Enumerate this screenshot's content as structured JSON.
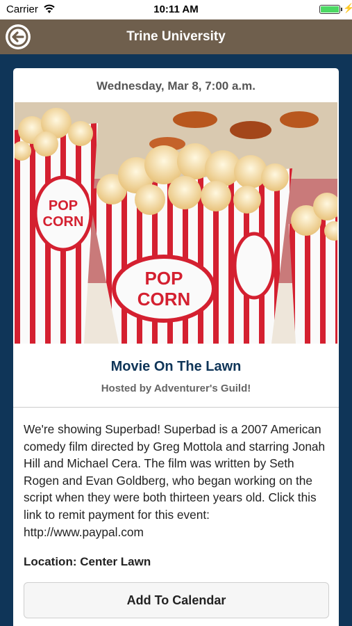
{
  "status_bar": {
    "carrier": "Carrier",
    "time": "10:11 AM"
  },
  "nav": {
    "title": "Trine University"
  },
  "event": {
    "date": "Wednesday, Mar 8, 7:00 a.m.",
    "title": "Movie On The Lawn",
    "host": "Hosted by Adventurer's Guild!",
    "description": "We're showing Superbad! Superbad is a 2007 American comedy film directed by Greg Mottola and starring Jonah Hill and Michael Cera. The film was written by Seth Rogen and Evan Goldberg, who began working on the script when they were both thirteen years old. Click this link to remit payment for this event: http://www.paypal.com",
    "location": "Location: Center Lawn",
    "calendar_button": "Add To Calendar",
    "image_labels": {
      "pop": "POP",
      "corn": "CORN"
    }
  },
  "colors": {
    "nav": "#6f5f4d",
    "background": "#0f3558",
    "title": "#0f3558",
    "popcorn_red": "#d42030"
  },
  "icons": {
    "back": "back-arrow-icon",
    "wifi": "wifi-icon",
    "battery": "battery-icon"
  }
}
